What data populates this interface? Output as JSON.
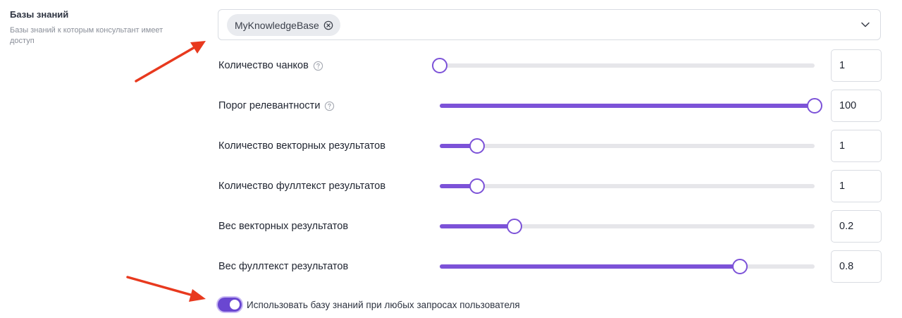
{
  "section": {
    "title": "Базы знаний",
    "description": "Базы знаний к которым консультант имеет доступ"
  },
  "kb_select": {
    "selected_tags": [
      "MyKnowledgeBase"
    ]
  },
  "sliders": [
    {
      "label": "Количество чанков",
      "value": "1",
      "fraction": 0.0,
      "has_help": true
    },
    {
      "label": "Порог релевантности",
      "value": "100",
      "fraction": 1.0,
      "has_help": true
    },
    {
      "label": "Количество векторных результатов",
      "value": "1",
      "fraction": 0.1,
      "has_help": false
    },
    {
      "label": "Количество фуллтекст результатов",
      "value": "1",
      "fraction": 0.1,
      "has_help": false
    },
    {
      "label": "Вес векторных результатов",
      "value": "0.2",
      "fraction": 0.2,
      "has_help": false
    },
    {
      "label": "Вес фуллтекст результатов",
      "value": "0.8",
      "fraction": 0.8,
      "has_help": false
    }
  ],
  "toggle": {
    "label": "Использовать базу знаний при любых запросах пользователя",
    "on": true
  },
  "colors": {
    "accent": "#7c52d8",
    "track": "#e6e6ea",
    "arrow": "#e8391e"
  },
  "icons": {
    "tag_remove": "close-circle-icon",
    "dropdown": "chevron-down-icon",
    "help": "question-circle-icon"
  }
}
